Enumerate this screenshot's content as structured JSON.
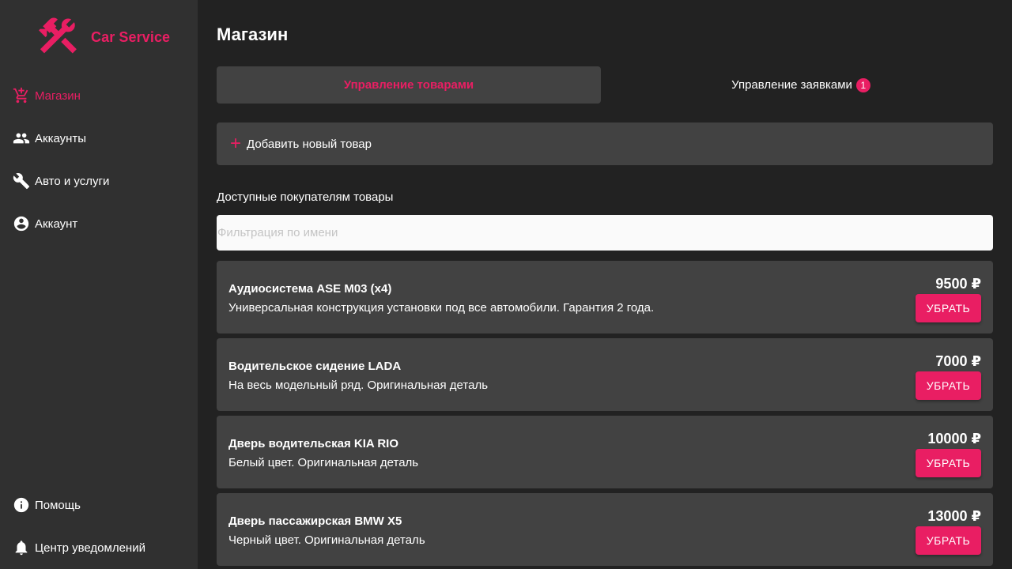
{
  "app": {
    "name": "Car Service",
    "accent_color": "#e91e63",
    "logo_icon": "tools-icon"
  },
  "sidebar": {
    "items": [
      {
        "label": "Магазин",
        "icon": "cart-icon",
        "active": true
      },
      {
        "label": "Аккаунты",
        "icon": "people-icon",
        "active": false
      },
      {
        "label": "Авто и услуги",
        "icon": "wrench-icon",
        "active": false
      },
      {
        "label": "Аккаунт",
        "icon": "account-circle-icon",
        "active": false
      }
    ],
    "bottom_items": [
      {
        "label": "Помощь",
        "icon": "info-icon"
      },
      {
        "label": "Центр уведомлений",
        "icon": "bell-icon"
      }
    ]
  },
  "main": {
    "title": "Магазин",
    "tabs": [
      {
        "label": "Управление товарами",
        "active": true
      },
      {
        "label": "Управление заявками",
        "active": false,
        "badge": "1"
      }
    ],
    "add_button_label": "Добавить новый товар",
    "section_label": "Доступные покупателям товары",
    "filter_placeholder": "Фильтрация по имени",
    "filter_value": "",
    "remove_label": "УБРАТЬ",
    "products": [
      {
        "name": "Аудиосистема ASE M03 (x4)",
        "description": "Универсальная конструкция установки под все автомобили. Гарантия 2 года.",
        "price": "9500 ₽"
      },
      {
        "name": "Водительское сидение LADA",
        "description": "На весь модельный ряд. Оригинальная деталь",
        "price": "7000 ₽"
      },
      {
        "name": "Дверь водительская KIA RIO",
        "description": "Белый цвет. Оригинальная деталь",
        "price": "10000 ₽"
      },
      {
        "name": "Дверь пассажирская BMW X5",
        "description": "Черный цвет. Оригинальная деталь",
        "price": "13000 ₽"
      }
    ]
  }
}
